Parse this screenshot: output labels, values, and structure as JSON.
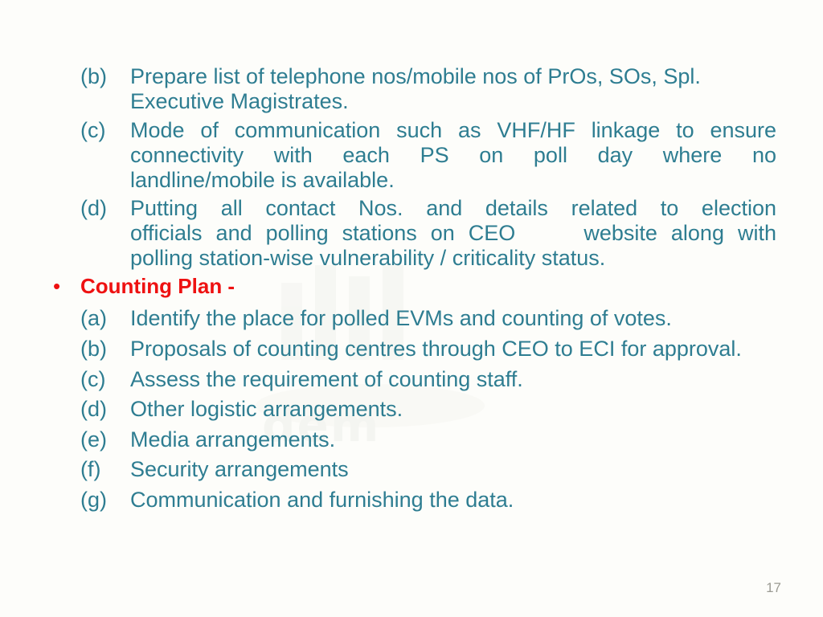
{
  "slide": {
    "page_number": "17",
    "text_color": "#2e7d91",
    "accent_color": "#ee1111",
    "background_color": "#fdfdfa",
    "watermark_text": "dem"
  },
  "top_list": [
    {
      "label": "(b)",
      "lines": [
        "Prepare list of telephone nos/mobile nos of PrOs, SOs, Spl.",
        "Executive Magistrates."
      ],
      "justified": false
    },
    {
      "label": "(c)",
      "lines": [
        "Mode of communication such as VHF/HF linkage to ensure",
        "connectivity with each PS on poll day where no",
        "landline/mobile is available."
      ],
      "justified": true
    },
    {
      "label": "(d)",
      "lines": [
        "Putting all contact Nos. and details related to election",
        "officials and polling stations on CEO     website along with",
        "polling station-wise vulnerability / criticality status."
      ],
      "justified": true
    }
  ],
  "counting_plan": {
    "bullet": "•",
    "heading": "Counting Plan -",
    "items": [
      {
        "label": "(a)",
        "text": "Identify the place for polled EVMs and counting of votes."
      },
      {
        "label": "(b)",
        "text": "Proposals of counting centres through CEO to ECI for approval."
      },
      {
        "label": "(c)",
        "text": "Assess the requirement of counting staff."
      },
      {
        "label": "(d)",
        "text": "Other logistic arrangements."
      },
      {
        "label": "(e)",
        "text": "Media arrangements."
      },
      {
        "label": "(f)",
        "text": "Security arrangements"
      },
      {
        "label": "(g)",
        "text": "Communication and furnishing the data."
      }
    ]
  }
}
